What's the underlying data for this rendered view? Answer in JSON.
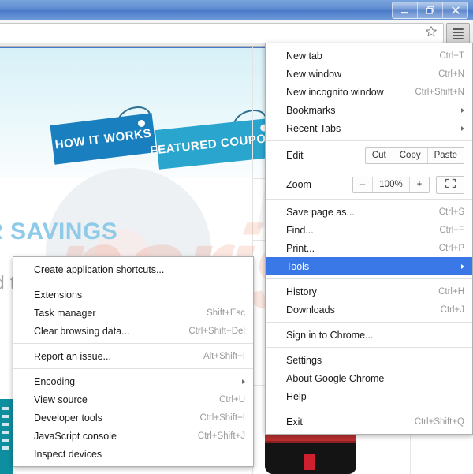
{
  "window": {
    "controls": [
      {
        "name": "minimize",
        "glyph": "minimize-icon"
      },
      {
        "name": "restore",
        "glyph": "restore-icon"
      },
      {
        "name": "close",
        "glyph": "close-icon"
      }
    ]
  },
  "toolbar": {
    "omnibox_value": "",
    "omnibox_placeholder": "",
    "star_icon": "star-icon",
    "menu_icon": "hamburger-menu-icon"
  },
  "page": {
    "tag1": "HOW IT WORKS",
    "tag2": "FEATURED COUPONS",
    "headline": "R SAVINGS",
    "subline": "nd the Deal.",
    "watermark": "pcrisk",
    "watermark2": "pcrisk"
  },
  "main_menu": {
    "items": [
      {
        "label": "New tab",
        "accel": "Ctrl+T",
        "type": "item",
        "name": "menu-item-new-tab"
      },
      {
        "label": "New window",
        "accel": "Ctrl+N",
        "type": "item",
        "name": "menu-item-new-window"
      },
      {
        "label": "New incognito window",
        "accel": "Ctrl+Shift+N",
        "type": "item",
        "name": "menu-item-new-incognito-window"
      },
      {
        "label": "Bookmarks",
        "accel": "",
        "type": "submenu",
        "name": "menu-item-bookmarks"
      },
      {
        "label": "Recent Tabs",
        "accel": "",
        "type": "submenu",
        "name": "menu-item-recent-tabs"
      },
      {
        "type": "separator"
      },
      {
        "label": "Edit",
        "type": "edit-row",
        "name": "menu-row-edit",
        "buttons": [
          "Cut",
          "Copy",
          "Paste"
        ]
      },
      {
        "type": "separator"
      },
      {
        "label": "Zoom",
        "type": "zoom-row",
        "name": "menu-row-zoom",
        "minus": "–",
        "value": "100%",
        "plus": "+",
        "fullscreen_icon": "fullscreen-icon"
      },
      {
        "type": "separator"
      },
      {
        "label": "Save page as...",
        "accel": "Ctrl+S",
        "type": "item",
        "name": "menu-item-save-page-as"
      },
      {
        "label": "Find...",
        "accel": "Ctrl+F",
        "type": "item",
        "name": "menu-item-find"
      },
      {
        "label": "Print...",
        "accel": "Ctrl+P",
        "type": "item",
        "name": "menu-item-print"
      },
      {
        "label": "Tools",
        "accel": "",
        "type": "submenu",
        "selected": true,
        "name": "menu-item-tools"
      },
      {
        "type": "separator"
      },
      {
        "label": "History",
        "accel": "Ctrl+H",
        "type": "item",
        "name": "menu-item-history"
      },
      {
        "label": "Downloads",
        "accel": "Ctrl+J",
        "type": "item",
        "name": "menu-item-downloads"
      },
      {
        "type": "separator"
      },
      {
        "label": "Sign in to Chrome...",
        "accel": "",
        "type": "item",
        "name": "menu-item-sign-in-to-chrome"
      },
      {
        "type": "separator"
      },
      {
        "label": "Settings",
        "accel": "",
        "type": "item",
        "name": "menu-item-settings"
      },
      {
        "label": "About Google Chrome",
        "accel": "",
        "type": "item",
        "name": "menu-item-about-google-chrome"
      },
      {
        "label": "Help",
        "accel": "",
        "type": "item",
        "name": "menu-item-help"
      },
      {
        "type": "separator"
      },
      {
        "label": "Exit",
        "accel": "Ctrl+Shift+Q",
        "type": "item",
        "name": "menu-item-exit"
      }
    ]
  },
  "tools_submenu": {
    "items": [
      {
        "label": "Create application shortcuts...",
        "accel": "",
        "type": "item",
        "name": "submenu-item-create-application-shortcuts"
      },
      {
        "type": "separator"
      },
      {
        "label": "Extensions",
        "accel": "",
        "type": "item",
        "name": "submenu-item-extensions"
      },
      {
        "label": "Task manager",
        "accel": "Shift+Esc",
        "type": "item",
        "name": "submenu-item-task-manager"
      },
      {
        "label": "Clear browsing data...",
        "accel": "Ctrl+Shift+Del",
        "type": "item",
        "name": "submenu-item-clear-browsing-data"
      },
      {
        "type": "separator"
      },
      {
        "label": "Report an issue...",
        "accel": "Alt+Shift+I",
        "type": "item",
        "name": "submenu-item-report-an-issue"
      },
      {
        "type": "separator"
      },
      {
        "label": "Encoding",
        "accel": "",
        "type": "submenu",
        "name": "submenu-item-encoding"
      },
      {
        "label": "View source",
        "accel": "Ctrl+U",
        "type": "item",
        "name": "submenu-item-view-source"
      },
      {
        "label": "Developer tools",
        "accel": "Ctrl+Shift+I",
        "type": "item",
        "name": "submenu-item-developer-tools"
      },
      {
        "label": "JavaScript console",
        "accel": "Ctrl+Shift+J",
        "type": "item",
        "name": "submenu-item-javascript-console"
      },
      {
        "label": "Inspect devices",
        "accel": "",
        "type": "item",
        "name": "submenu-item-inspect-devices"
      }
    ]
  },
  "colors": {
    "accent": "#3b78e7",
    "titlebar": "#4a79c7",
    "tag_dark": "#1a7fbe",
    "tag_light": "#2aa5ce",
    "headline": "#8ecbe8"
  }
}
